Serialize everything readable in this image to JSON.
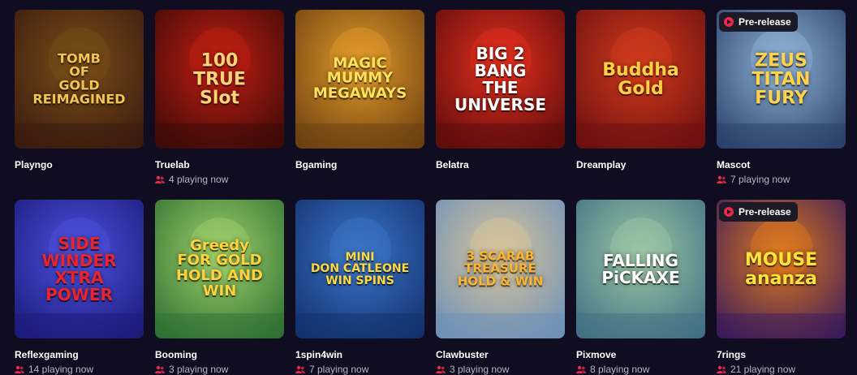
{
  "cards": [
    {
      "provider": "Playngo",
      "players": "",
      "badge": "",
      "art": "TOMB\nOF\nGOLD\nREIMAGINED",
      "bg1": "#3a1a0f",
      "bg2": "#7a4e18",
      "art_color": "#f3c451",
      "art_size": 16
    },
    {
      "provider": "Truelab",
      "players": "4 playing now",
      "badge": "",
      "art": "100\nTRUE\nSlot",
      "bg1": "#3b0a08",
      "bg2": "#c21e12",
      "art_color": "#ffd37a",
      "art_size": 22
    },
    {
      "provider": "Bgaming",
      "players": "",
      "badge": "",
      "art": "MAGIC\nMUMMY\nMEGAWAYS",
      "bg1": "#6a3f10",
      "bg2": "#e39a2b",
      "art_color": "#ffe25a",
      "art_size": 18
    },
    {
      "provider": "Belatra",
      "players": "",
      "badge": "",
      "art": "BIG 2\nBANG\nTHE UNIVERSE",
      "bg1": "#5c0c0c",
      "bg2": "#e42f1e",
      "art_color": "#ffffff",
      "art_size": 20
    },
    {
      "provider": "Dreamplay",
      "players": "",
      "badge": "",
      "art": "Buddha\nGold",
      "bg1": "#6b0f10",
      "bg2": "#d23b1c",
      "art_color": "#ffcf45",
      "art_size": 22
    },
    {
      "provider": "Mascot",
      "players": "7 playing now",
      "badge": "Pre-release",
      "art": "ZEUS\nTITAN FURY",
      "bg1": "#2a3f6a",
      "bg2": "#8fb3d6",
      "art_color": "#ffd24a",
      "art_size": 22
    },
    {
      "provider": "Reflexgaming",
      "players": "14 playing now",
      "badge": "",
      "art": "SIDE\nWINDER\nXTRA POWER",
      "bg1": "#1c1a7a",
      "bg2": "#4d52e0",
      "art_color": "#e8242e",
      "art_size": 20
    },
    {
      "provider": "Booming",
      "players": "3 playing now",
      "badge": "",
      "art": "Greedy\nFOR GOLD\nHOLD AND WIN",
      "bg1": "#2e6f33",
      "bg2": "#9fd16a",
      "art_color": "#ffd23c",
      "art_size": 18
    },
    {
      "provider": "1spin4win",
      "players": "7 playing now",
      "badge": "",
      "art": "MINI\nDON CATLEONE\nWIN SPINS",
      "bg1": "#12306e",
      "bg2": "#3c76c8",
      "art_color": "#ffd83d",
      "art_size": 14
    },
    {
      "provider": "Clawbuster",
      "players": "3 playing now",
      "badge": "",
      "art": "3 SCARAB\nTREASURE\nHOLD & WIN",
      "bg1": "#6c8fb8",
      "bg2": "#d9c69a",
      "art_color": "#ffb52e",
      "art_size": 15
    },
    {
      "provider": "Pixmove",
      "players": "8 playing now",
      "badge": "",
      "art": "FALLING\nPiCKAXE",
      "bg1": "#3f6f84",
      "bg2": "#9cc7a4",
      "art_color": "#ffffff",
      "art_size": 20
    },
    {
      "provider": "7rings",
      "players": "21 playing now",
      "badge": "Pre-release",
      "art": "MOUSE\nananza",
      "bg1": "#3a1a5c",
      "bg2": "#e07a1c",
      "art_color": "#ffe23a",
      "art_size": 22
    }
  ]
}
